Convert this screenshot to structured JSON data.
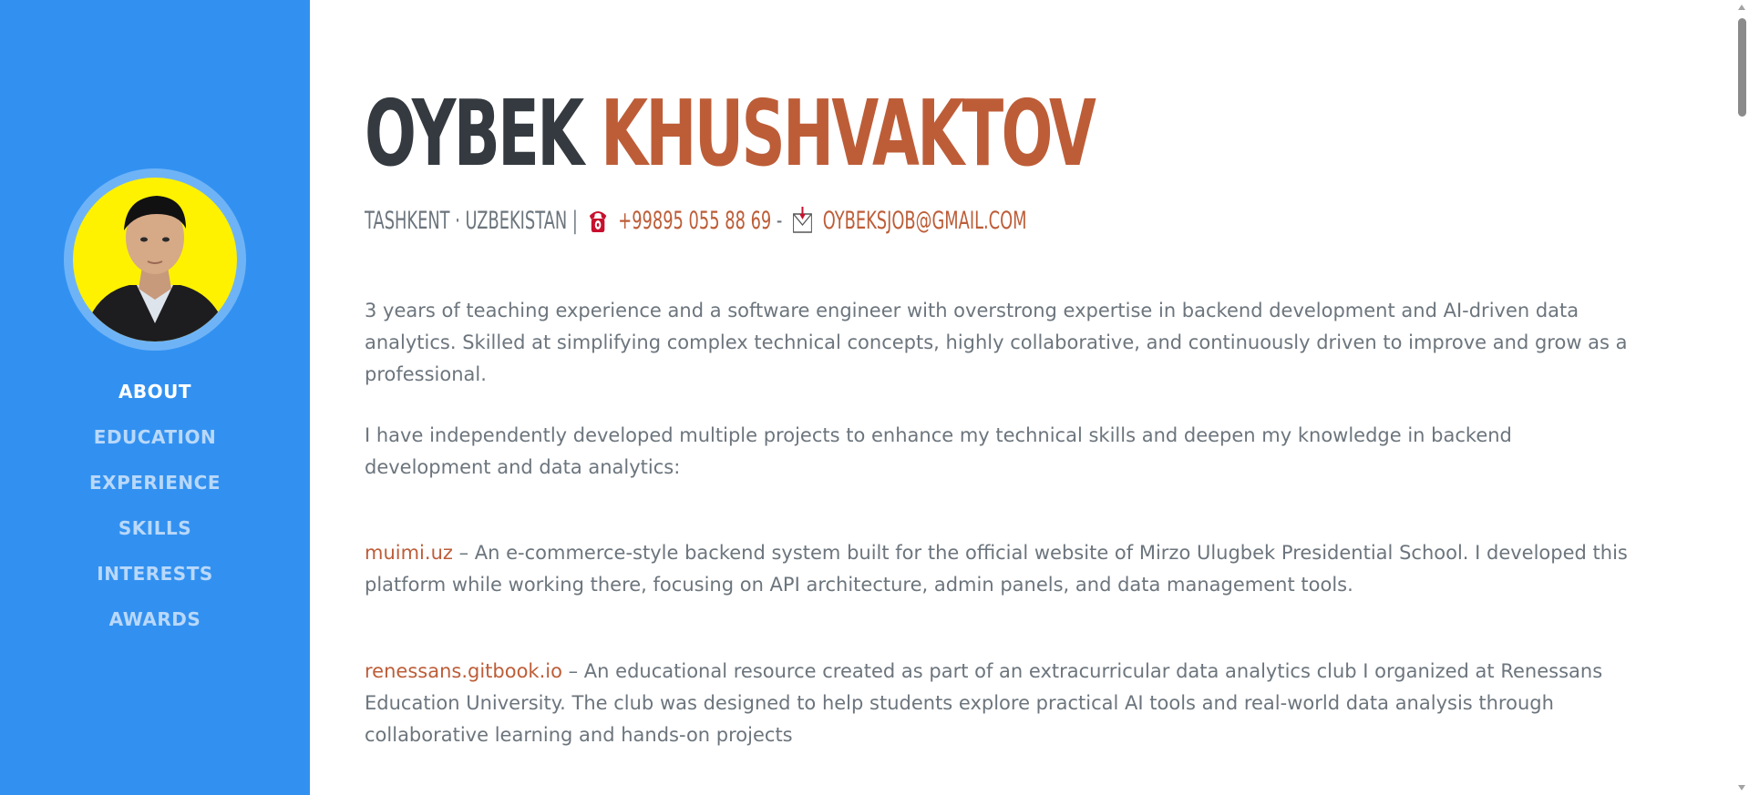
{
  "profile": {
    "first_name": "OYBEK",
    "last_name": "KHUSHVAKTOV",
    "location": "TASHKENT · UZBEKISTAN |",
    "phone": "+99895 055 88 69",
    "separator": "-",
    "email": "OYBEKSJOB@GMAIL.COM"
  },
  "nav": {
    "items": [
      {
        "label": "ABOUT"
      },
      {
        "label": "EDUCATION"
      },
      {
        "label": "EXPERIENCE"
      },
      {
        "label": "SKILLS"
      },
      {
        "label": "INTERESTS"
      },
      {
        "label": "AWARDS"
      }
    ],
    "active": "ABOUT"
  },
  "about": {
    "intro": "3 years of teaching experience and a software engineer with overstrong expertise in backend development and AI-driven data analytics. Skilled at simplifying complex technical concepts, highly collaborative, and continuously driven to improve and grow as a professional.",
    "projects_intro": "I have independently developed multiple projects to enhance my technical skills and deepen my knowledge in backend development and data analytics:",
    "projects": [
      {
        "link": "muimi.uz",
        "description": " – An e-commerce-style backend system built for the official website of Mirzo Ulugbek Presidential School. I developed this platform while working there, focusing on API architecture, admin panels, and data management tools."
      },
      {
        "link": "renessans.gitbook.io",
        "description": " – An educational resource created as part of an extracurricular data analytics club I organized at Renessans Education University. The club was designed to help students explore practical AI tools and real-world data analysis through collaborative learning and hands-on projects"
      }
    ]
  },
  "colors": {
    "sidebar": "#3291f0",
    "accent": "#bd5d38",
    "heading": "#343a40",
    "body_text": "#6c757d",
    "avatar_background": "#fff200"
  },
  "icons": {
    "phone": "telephone-icon",
    "email": "envelope-icon"
  }
}
